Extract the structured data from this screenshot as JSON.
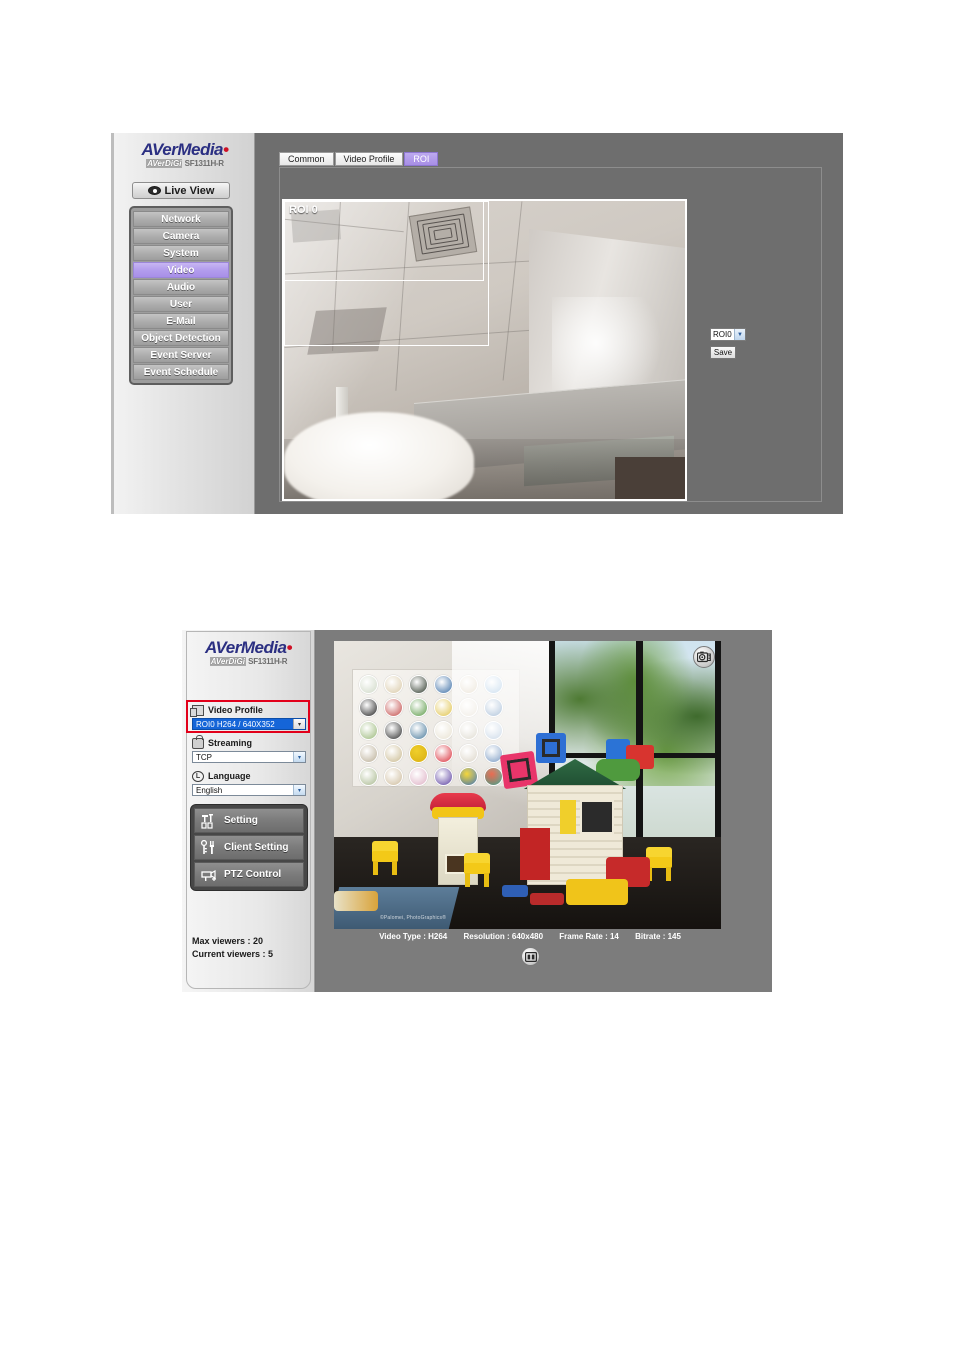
{
  "figure1": {
    "brand": {
      "name_a": "AVer",
      "name_b": "Media",
      "trademark": "•",
      "sub_a": "AVerDiGi",
      "sub_b": "SF1311H-R"
    },
    "live_view_button": "Live View",
    "menu_items": [
      {
        "label": "Network",
        "active": false
      },
      {
        "label": "Camera",
        "active": false
      },
      {
        "label": "System",
        "active": false
      },
      {
        "label": "Video",
        "active": true
      },
      {
        "label": "Audio",
        "active": false
      },
      {
        "label": "User",
        "active": false
      },
      {
        "label": "E-Mail",
        "active": false
      },
      {
        "label": "Object Detection",
        "active": false
      },
      {
        "label": "Event Server",
        "active": false
      },
      {
        "label": "Event Schedule",
        "active": false
      }
    ],
    "tabs": [
      {
        "label": "Common",
        "active": false
      },
      {
        "label": "Video Profile",
        "active": false
      },
      {
        "label": "ROI",
        "active": true
      }
    ],
    "video_overlay_label": "ROI 0",
    "roi_select_value": "ROI0",
    "roi_select_arrow": "▼",
    "save_button": "Save",
    "accent_color": "#a78ee6"
  },
  "figure2": {
    "brand": {
      "name_a": "AVer",
      "name_b": "Media",
      "trademark": "•",
      "sub_a": "AVerDiGi",
      "sub_b": "SF1311H-R"
    },
    "controls": [
      {
        "label": "Video Profile",
        "value": "ROI0 H264 / 640X352",
        "icon": "video-profile-icon",
        "selected": true
      },
      {
        "label": "Streaming",
        "value": "TCP",
        "icon": "streaming-icon",
        "selected": false
      },
      {
        "label": "Language",
        "value": "English",
        "icon": "language-icon",
        "selected": false
      }
    ],
    "action_buttons": [
      {
        "label": "Setting",
        "icon": "setting-icon"
      },
      {
        "label": "Client Setting",
        "icon": "client-setting-icon"
      },
      {
        "label": "PTZ Control",
        "icon": "ptz-control-icon"
      }
    ],
    "viewers": {
      "max": "Max viewers : 20",
      "current": "Current viewers : 5"
    },
    "video_info": {
      "video_type": "Video Type : H264",
      "resolution": "Resolution : 640x480",
      "frame_rate": "Frame Rate : 14",
      "bitrate": "Bitrate : 145"
    },
    "video_watermark": "©Palomei, PhotoGraphics®",
    "snapshot_button": "snapshot-icon",
    "fullscreen_button": "fullscreen-icon",
    "highlight_color": "#e2001a",
    "selected_option_color": "#1565d8"
  }
}
